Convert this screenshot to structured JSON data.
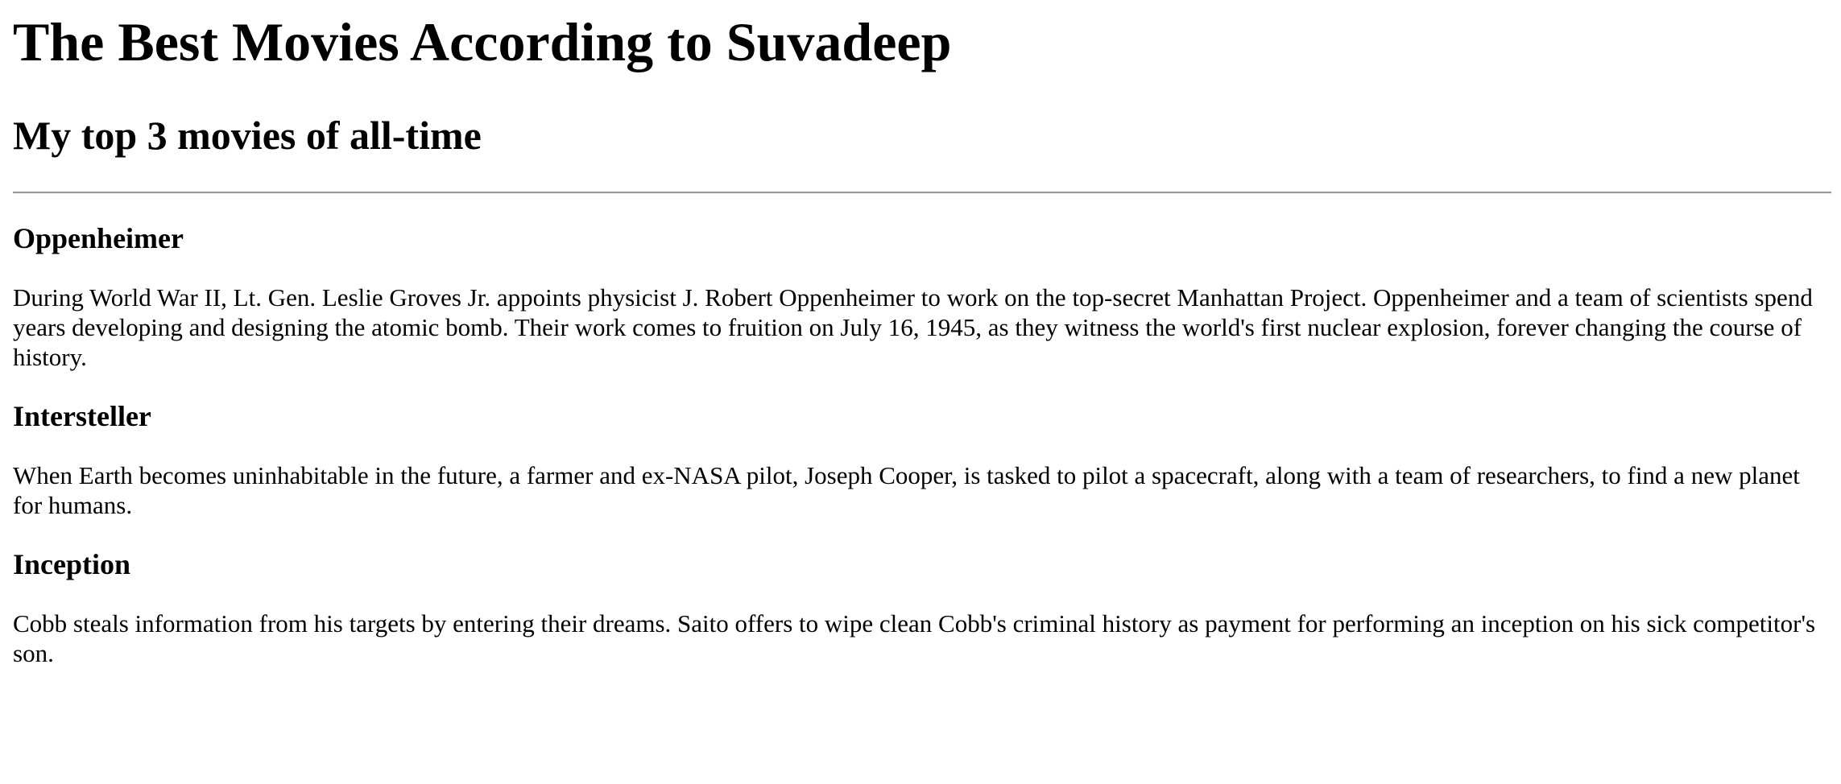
{
  "page": {
    "title": "The Best Movies According to Suvadeep",
    "subtitle": "My top 3 movies of all-time"
  },
  "movies": [
    {
      "title": "Oppenheimer",
      "description": "During World War II, Lt. Gen. Leslie Groves Jr. appoints physicist J. Robert Oppenheimer to work on the top-secret Manhattan Project. Oppenheimer and a team of scientists spend years developing and designing the atomic bomb. Their work comes to fruition on July 16, 1945, as they witness the world's first nuclear explosion, forever changing the course of history."
    },
    {
      "title": "Intersteller",
      "description": "When Earth becomes uninhabitable in the future, a farmer and ex-NASA pilot, Joseph Cooper, is tasked to pilot a spacecraft, along with a team of researchers, to find a new planet for humans."
    },
    {
      "title": "Inception",
      "description": "Cobb steals information from his targets by entering their dreams. Saito offers to wipe clean Cobb's criminal history as payment for performing an inception on his sick competitor's son."
    }
  ]
}
